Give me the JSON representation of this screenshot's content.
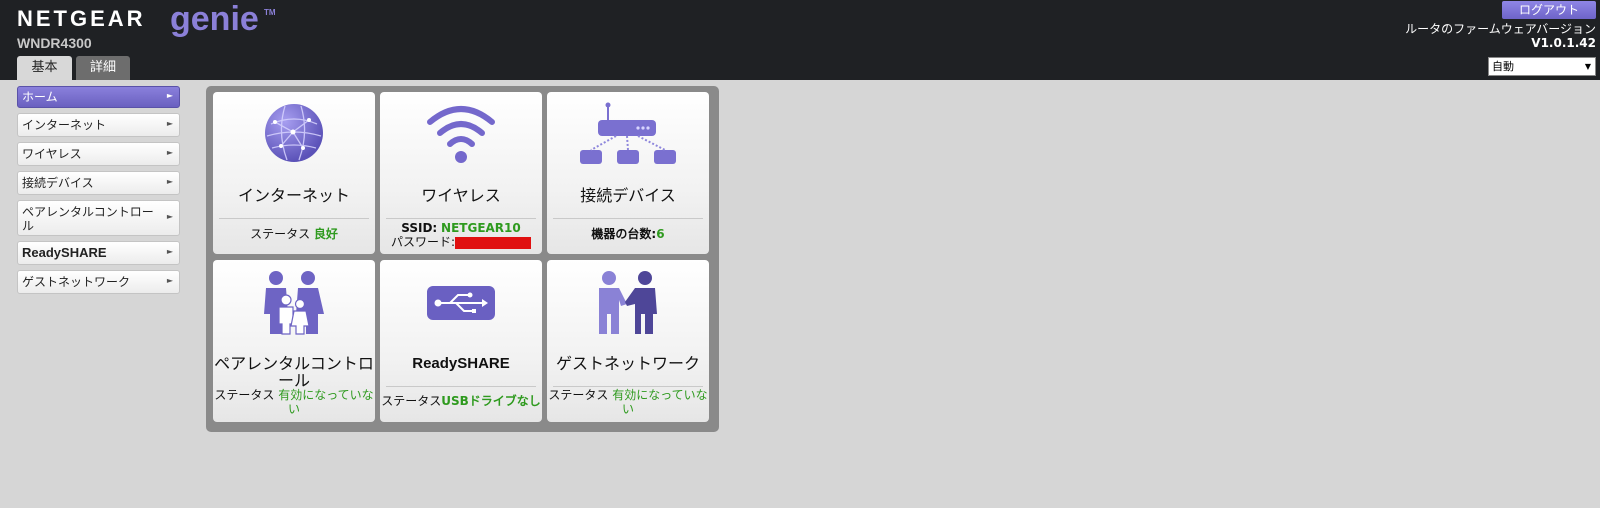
{
  "header": {
    "brand": "NETGEAR",
    "product": "genie",
    "trademark": "TM",
    "model": "WNDR4300",
    "tabs": [
      {
        "label": "基本",
        "active": true
      },
      {
        "label": "詳細",
        "active": false
      }
    ],
    "logout_label": "ログアウト",
    "firmware_label": "ルータのファームウェアバージョン",
    "firmware_version": "V1.0.1.42",
    "language_selected": "自動"
  },
  "sidebar": {
    "items": [
      {
        "label": "ホーム",
        "active": true
      },
      {
        "label": "インターネット",
        "active": false
      },
      {
        "label": "ワイヤレス",
        "active": false
      },
      {
        "label": "接続デバイス",
        "active": false
      },
      {
        "label": "ペアレンタルコントロール",
        "active": false
      },
      {
        "label": "ReadySHARE",
        "active": false
      },
      {
        "label": "ゲストネットワーク",
        "active": false
      }
    ]
  },
  "dashboard": {
    "internet": {
      "title": "インターネット",
      "status_label": "ステータス",
      "status_value": "良好",
      "icon": "globe-icon"
    },
    "wireless": {
      "title": "ワイヤレス",
      "ssid_label": "SSID:",
      "ssid_value": "NETGEAR10",
      "password_label": "パスワード:",
      "icon": "wifi-icon"
    },
    "devices": {
      "title": "接続デバイス",
      "count_label": "機器の台数:",
      "count_value": "6",
      "icon": "network-devices-icon"
    },
    "parental": {
      "title": "ペアレンタルコントロール",
      "status_label": "ステータス",
      "status_value": "有効になっていない",
      "icon": "family-icon"
    },
    "readyshare": {
      "title": "ReadySHARE",
      "status_label": "ステータス",
      "status_value": "USBドライブなし",
      "icon": "usb-icon"
    },
    "guest": {
      "title": "ゲストネットワーク",
      "status_label": "ステータス",
      "status_value": "有効になっていない",
      "icon": "handshake-icon"
    }
  },
  "colors": {
    "accent": "#7b70d4",
    "header_bg": "#1f2124",
    "status_green": "#2e9a1e",
    "page_bg": "#d6d6d6"
  }
}
